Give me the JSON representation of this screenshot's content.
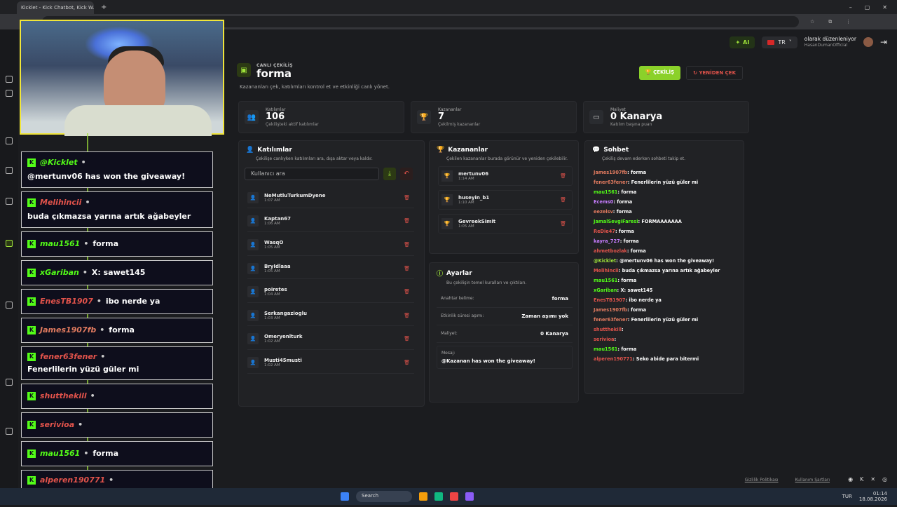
{
  "browser": {
    "tab_title": "Kicklet - Kick Chatbot, Kick W...",
    "new_tab_icon": "plus-icon"
  },
  "header": {
    "ai_label": "AI",
    "lang_label": "TR",
    "user_line1": "olarak düzenleniyor",
    "user_line2": "HasanDumanOfficial"
  },
  "giveaway": {
    "kicker": "CANLI ÇEKİLİŞ",
    "title": "forma",
    "subtitle": "Kazananları çek, katılımları kontrol et ve etkinliği canlı yönet.",
    "draw_button": "ÇEKİLİŞ",
    "redraw_button": "YENİDEN ÇEK"
  },
  "stats": [
    {
      "key": "Katılımlar",
      "value": "106",
      "sub": "Çekilişteki aktif katılımlar"
    },
    {
      "key": "Kazananlar",
      "value": "7",
      "sub": "Çekilmiş kazananlar"
    },
    {
      "key": "Maliyet",
      "value": "0 Kanarya",
      "sub": "Katılım başına puan"
    }
  ],
  "participants": {
    "title": "Katılımlar",
    "subtitle": "Çekilişe canlıyken katılımları ara, dışa aktar veya kaldır.",
    "search_placeholder": "Kullanıcı ara",
    "items": [
      {
        "name": "NeMutluTurkumDyene",
        "time": "1:07 AM"
      },
      {
        "name": "Kaptan67",
        "time": "1:06 AM"
      },
      {
        "name": "WasqO",
        "time": "1:05 AM"
      },
      {
        "name": "BryIdlaaa",
        "time": "1:05 AM"
      },
      {
        "name": "poiretes",
        "time": "1:04 AM"
      },
      {
        "name": "Serkangazioglu",
        "time": "1:03 AM"
      },
      {
        "name": "Omeryenlturk",
        "time": "1:02 AM"
      },
      {
        "name": "Musti45musti",
        "time": "1:02 AM"
      }
    ]
  },
  "winners": {
    "title": "Kazananlar",
    "subtitle": "Çekilen kazananlar burada görünür ve yeniden çekilebilir.",
    "items": [
      {
        "name": "mertunv06",
        "time": "1:14 AM"
      },
      {
        "name": "huseyin_b1",
        "time": "1:10 AM"
      },
      {
        "name": "GevreekSimit",
        "time": "1:05 AM"
      }
    ]
  },
  "settings": {
    "title": "Ayarlar",
    "subtitle": "Bu çekilişin temel kuralları ve çıktıları.",
    "rows": [
      {
        "label": "Anahtar kelime:",
        "value": "forma"
      },
      {
        "label": "Etkinlik süresi aşımı:",
        "value": "Zaman aşımı yok"
      },
      {
        "label": "Maliyet:",
        "value": "0 Kanarya"
      }
    ],
    "message_label": "Mesaj:",
    "message_value": "@Kazanan has won the giveaway!"
  },
  "chat": {
    "title": "Sohbet",
    "subtitle": "Çekiliş devam ederken sohbeti takip et.",
    "messages": [
      {
        "user": "James1907fb",
        "text": "forma",
        "color": "#e07a5f"
      },
      {
        "user": "fener63fener",
        "text": "Fenerlilerin yüzü güler mi",
        "color": "#e07a5f"
      },
      {
        "user": "mau1561",
        "text": "forma",
        "color": "#53fc18"
      },
      {
        "user": "Ecems0",
        "text": "forma",
        "color": "#c77dff"
      },
      {
        "user": "eezelsv",
        "text": "forma",
        "color": "#e07a5f"
      },
      {
        "user": "JamalSevgiFaresi",
        "text": "FORMAAAAAAA",
        "color": "#53fc18"
      },
      {
        "user": "ReDie47",
        "text": "forma",
        "color": "#e2534b"
      },
      {
        "user": "kayra_727",
        "text": "forma",
        "color": "#c77dff"
      },
      {
        "user": "ahmetbozlak",
        "text": "forma",
        "color": "#e2534b"
      },
      {
        "user": "@Kicklet",
        "text": "@mertunv06 has won the giveaway!",
        "color": "#9fe33a"
      },
      {
        "user": "Melihincii",
        "text": "buda çıkmazsa yarına artık ağabeyler",
        "color": "#e2534b"
      },
      {
        "user": "mau1561",
        "text": "forma",
        "color": "#53fc18"
      },
      {
        "user": "xGariban",
        "text": "X: sawet145",
        "color": "#53fc18"
      },
      {
        "user": "EnesTB1907",
        "text": "ibo nerde ya",
        "color": "#e2534b"
      },
      {
        "user": "James1907fb",
        "text": "forma",
        "color": "#e07a5f"
      },
      {
        "user": "fener63fener",
        "text": "Fenerlilerin yüzü güler mi",
        "color": "#e07a5f"
      },
      {
        "user": "shutthekill",
        "text": "",
        "color": "#e2534b"
      },
      {
        "user": "serivioa",
        "text": "",
        "color": "#e2534b"
      },
      {
        "user": "mau1561",
        "text": "forma",
        "color": "#53fc18"
      },
      {
        "user": "alperen190771",
        "text": "Seko abide para bitermi",
        "color": "#e2534b"
      }
    ]
  },
  "overlay": {
    "messages": [
      {
        "user": "@Kicklet",
        "text": "@mertunv06 has won the giveaway!",
        "color": "#53fc18"
      },
      {
        "user": "Melihincii",
        "text": "buda çıkmazsa yarına artık ağabeyler",
        "color": "#e2534b"
      },
      {
        "user": "mau1561",
        "text": "forma",
        "color": "#53fc18"
      },
      {
        "user": "xGariban",
        "text": "X: sawet145",
        "color": "#53fc18"
      },
      {
        "user": "EnesTB1907",
        "text": "ibo nerde ya",
        "color": "#e2534b"
      },
      {
        "user": "James1907fb",
        "text": "forma",
        "color": "#e07a5f"
      },
      {
        "user": "fener63fener",
        "text": "Fenerlilerin yüzü güler mi",
        "color": "#e2534b"
      },
      {
        "user": "shutthekill",
        "text": "",
        "color": "#e2534b"
      },
      {
        "user": "serivioa",
        "text": "",
        "color": "#e2534b"
      },
      {
        "user": "mau1561",
        "text": "forma",
        "color": "#53fc18"
      },
      {
        "user": "alperen190771",
        "text": "Seko abide para bitermi",
        "color": "#e2534b"
      }
    ]
  },
  "footer": {
    "privacy": "Gizlilik Politikası",
    "terms": "Kullanım Şartları"
  },
  "taskbar": {
    "search": "Search",
    "lang": "TUR",
    "time": "01:14",
    "date": "18.08.2026"
  }
}
